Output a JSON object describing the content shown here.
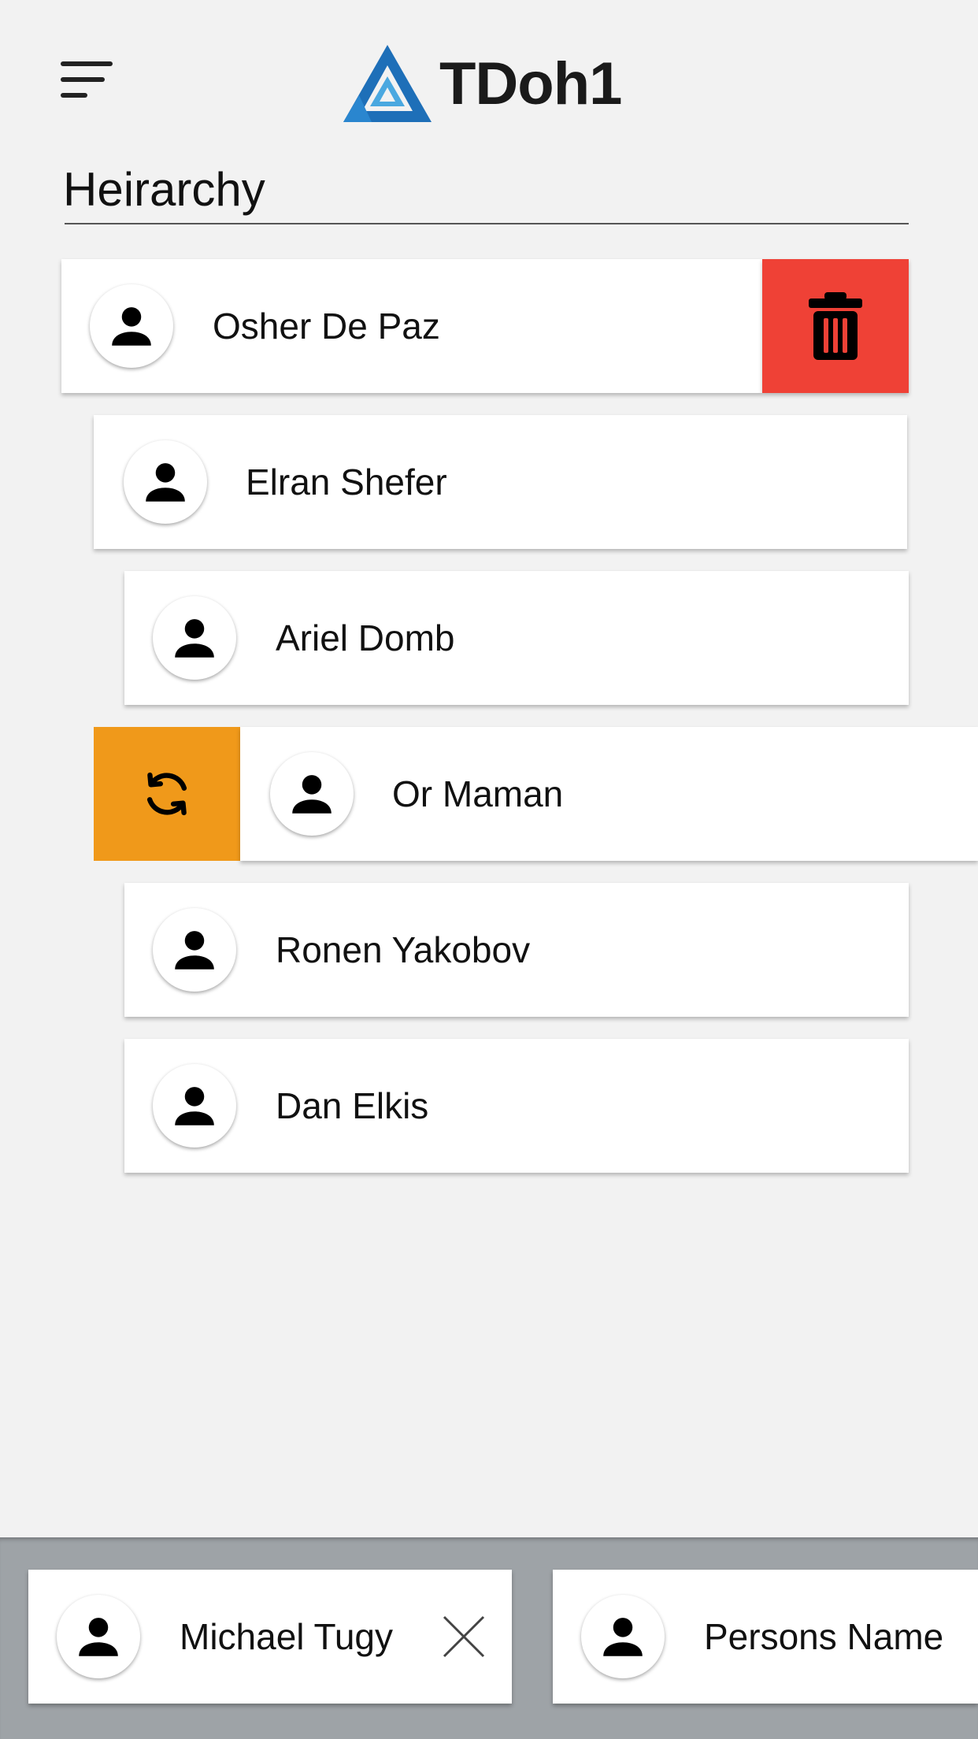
{
  "header": {
    "menu_icon": "hamburger-menu-icon",
    "logo_text": "TDoh1",
    "logo_colors": {
      "primary": "#1e6fb8",
      "secondary": "#4aa8e0"
    }
  },
  "page": {
    "title": "Heirarchy"
  },
  "hierarchy": {
    "items": [
      {
        "name": "Osher De Paz",
        "level": 0,
        "action": "delete"
      },
      {
        "name": "Elran Shefer",
        "level": 1
      },
      {
        "name": "Ariel Domb",
        "level": 2
      },
      {
        "name": "Or Maman",
        "level": 1,
        "action": "reassign"
      },
      {
        "name": "Ronen Yakobov",
        "level": 2
      },
      {
        "name": "Dan Elkis",
        "level": 2
      }
    ],
    "actions": {
      "delete_icon": "trash-icon",
      "delete_color": "#ef4136",
      "reassign_icon": "refresh-icon",
      "reassign_color": "#f0991a"
    }
  },
  "tray": {
    "background": "#9ea3a7",
    "items": [
      {
        "name": "Michael Tugy",
        "close_icon": "close-icon"
      },
      {
        "name": "Persons Name"
      }
    ]
  },
  "icons": {
    "avatar": "person-icon"
  }
}
